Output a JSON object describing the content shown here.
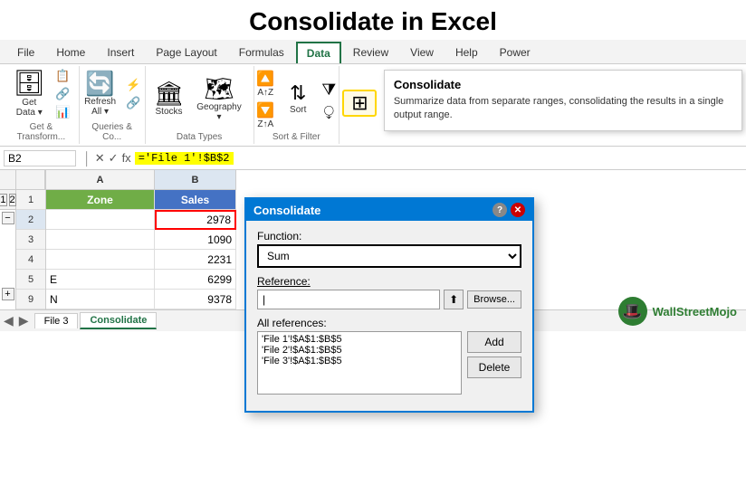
{
  "title": "Consolidate in Excel",
  "ribbon": {
    "tabs": [
      "File",
      "Home",
      "Insert",
      "Page Layout",
      "Formulas",
      "Data",
      "Review",
      "View",
      "Help",
      "Power"
    ],
    "active_tab": "Data",
    "groups": {
      "get_transform": {
        "label": "Get & Transform...",
        "buttons": [
          {
            "label": "Get\nData",
            "icon": "🗄"
          }
        ]
      },
      "queries": {
        "label": "Queries & Co...",
        "buttons": [
          {
            "label": "Refresh\nAll",
            "icon": "🔄"
          }
        ]
      },
      "data_types": {
        "label": "Data Types",
        "buttons": [
          {
            "label": "Stocks",
            "icon": "🏛"
          },
          {
            "label": "Geography",
            "icon": "🗺"
          }
        ]
      },
      "sort_filter": {
        "label": "Sort &...",
        "az_label": "A↑Z",
        "za_label": "Z↑A",
        "sort_label": "Sort",
        "filter_icon": "⧩"
      },
      "consolidate": {
        "icon": "🟨",
        "tooltip_title": "Consolidate",
        "tooltip_desc": "Summarize data from separate ranges, consolidating the results in a single output range."
      }
    }
  },
  "formula_bar": {
    "name_box": "B2",
    "formula": "='File 1'!$B$2"
  },
  "spreadsheet": {
    "columns": [
      "A",
      "B"
    ],
    "rows": [
      {
        "row_num": 1,
        "a": "Zone",
        "b": "Sales",
        "a_style": "header_zone",
        "b_style": "header_sales"
      },
      {
        "row_num": 2,
        "a": "",
        "b": "2978",
        "b_selected": true
      },
      {
        "row_num": 3,
        "a": "",
        "b": "1090"
      },
      {
        "row_num": 4,
        "a": "",
        "b": "2231"
      },
      {
        "row_num": 5,
        "a": "E",
        "b": "6299"
      },
      {
        "row_num": 9,
        "a": "N",
        "b": "9378"
      }
    ],
    "outline_nums": [
      "1",
      "2"
    ]
  },
  "sheet_tabs": [
    "File 3",
    "Consolidate"
  ],
  "active_sheet": "Consolidate",
  "dialog": {
    "title": "Consolidate",
    "function_label": "Function:",
    "function_value": "Sum",
    "reference_label": "Reference:",
    "reference_value": "|",
    "browse_btn": "Browse...",
    "all_references_label": "All references:",
    "all_references": [
      "'File 1'!$A$1:$B$5",
      "'File 2'!$A$1:$B$5",
      "'File 3'!$A$1:$B$5"
    ],
    "add_btn": "Add",
    "delete_btn": "Delete"
  },
  "watermark": "WallStreetMojo"
}
